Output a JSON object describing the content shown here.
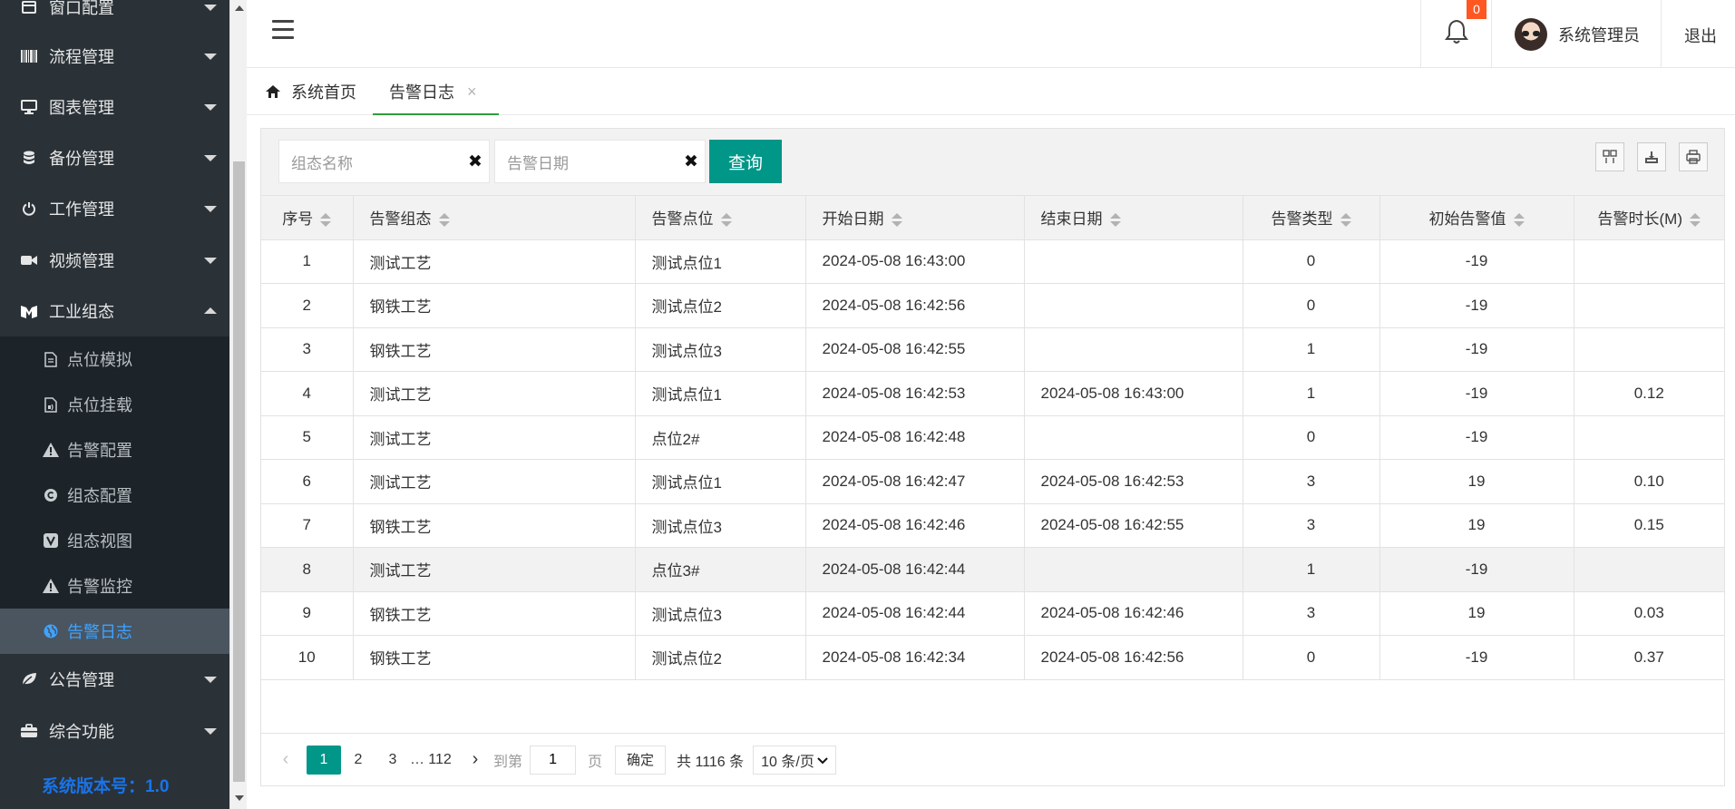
{
  "sidebar": {
    "menus": [
      {
        "label": "窗口配置",
        "icon": "window-icon"
      },
      {
        "label": "流程管理",
        "icon": "barcode-icon"
      },
      {
        "label": "图表管理",
        "icon": "monitor-icon"
      },
      {
        "label": "备份管理",
        "icon": "database-icon"
      },
      {
        "label": "工作管理",
        "icon": "power-icon"
      },
      {
        "label": "视频管理",
        "icon": "video-icon"
      },
      {
        "label": "工业组态",
        "icon": "m-logo-icon"
      }
    ],
    "submenus": [
      {
        "label": "点位模拟",
        "icon": "file-icon"
      },
      {
        "label": "点位挂载",
        "icon": "file-audio-icon"
      },
      {
        "label": "告警配置",
        "icon": "warning-icon"
      },
      {
        "label": "组态配置",
        "icon": "copyright-icon"
      },
      {
        "label": "组态视图",
        "icon": "v-square-icon"
      },
      {
        "label": "告警监控",
        "icon": "warning-icon"
      },
      {
        "label": "告警日志",
        "icon": "globe-icon"
      }
    ],
    "menus_after": [
      {
        "label": "公告管理",
        "icon": "leaf-icon"
      },
      {
        "label": "综合功能",
        "icon": "briefcase-icon"
      }
    ],
    "version": "系统版本号：1.0"
  },
  "header": {
    "notification_count": "0",
    "user_name": "系统管理员",
    "logout_label": "退出"
  },
  "tabs": {
    "home_label": "系统首页",
    "active_label": "告警日志"
  },
  "search": {
    "config_name_placeholder": "组态名称",
    "alarm_date_placeholder": "告警日期",
    "query_label": "查询"
  },
  "table": {
    "columns": [
      "序号",
      "告警组态",
      "告警点位",
      "开始日期",
      "结束日期",
      "告警类型",
      "初始告警值",
      "告警时长(M)"
    ],
    "rows": [
      [
        "1",
        "测试工艺",
        "测试点位1",
        "2024-05-08 16:43:00",
        "",
        "0",
        "-19",
        ""
      ],
      [
        "2",
        "钢铁工艺",
        "测试点位2",
        "2024-05-08 16:42:56",
        "",
        "0",
        "-19",
        ""
      ],
      [
        "3",
        "钢铁工艺",
        "测试点位3",
        "2024-05-08 16:42:55",
        "",
        "1",
        "-19",
        ""
      ],
      [
        "4",
        "测试工艺",
        "测试点位1",
        "2024-05-08 16:42:53",
        "2024-05-08 16:43:00",
        "1",
        "-19",
        "0.12"
      ],
      [
        "5",
        "测试工艺",
        "点位2#",
        "2024-05-08 16:42:48",
        "",
        "0",
        "-19",
        ""
      ],
      [
        "6",
        "测试工艺",
        "测试点位1",
        "2024-05-08 16:42:47",
        "2024-05-08 16:42:53",
        "3",
        "19",
        "0.10"
      ],
      [
        "7",
        "钢铁工艺",
        "测试点位3",
        "2024-05-08 16:42:46",
        "2024-05-08 16:42:55",
        "3",
        "19",
        "0.15"
      ],
      [
        "8",
        "测试工艺",
        "点位3#",
        "2024-05-08 16:42:44",
        "",
        "1",
        "-19",
        ""
      ],
      [
        "9",
        "钢铁工艺",
        "测试点位3",
        "2024-05-08 16:42:44",
        "2024-05-08 16:42:46",
        "3",
        "19",
        "0.03"
      ],
      [
        "10",
        "钢铁工艺",
        "测试点位2",
        "2024-05-08 16:42:34",
        "2024-05-08 16:42:56",
        "0",
        "-19",
        "0.37"
      ]
    ]
  },
  "pagination": {
    "pages": [
      "1",
      "2",
      "3"
    ],
    "ellipsis": "…",
    "last_page": "112",
    "goto_label": "到第",
    "goto_value": "1",
    "page_label": "页",
    "confirm_label": "确定",
    "total_text": "共 1116 条",
    "page_size": "10 条/页"
  },
  "colors": {
    "sidebar_bg": "#2a3238",
    "accent_teal": "#009688",
    "badge": "#ff5722",
    "active_link": "#3ea3ff",
    "version_text": "#1a73e8",
    "tab_underline": "#2f9e3a"
  }
}
